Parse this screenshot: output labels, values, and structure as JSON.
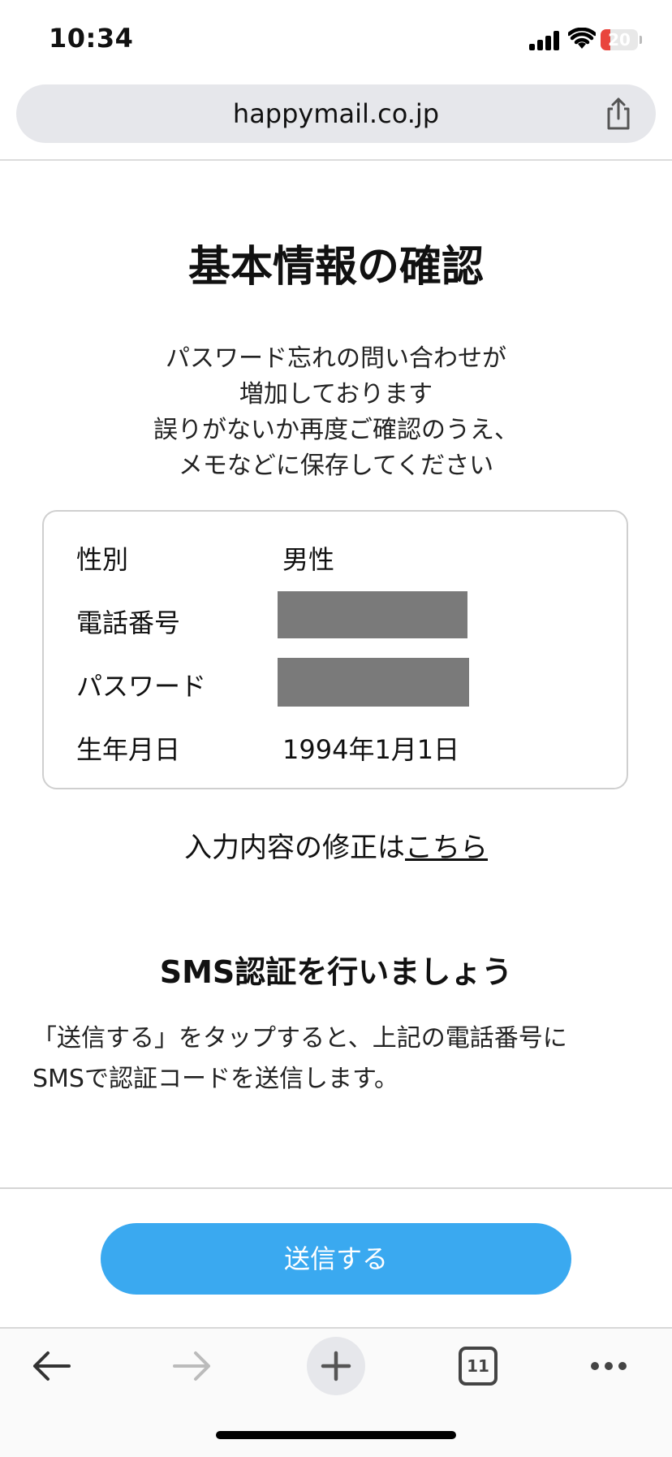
{
  "status_bar": {
    "time": "10:34",
    "battery": "20"
  },
  "browser": {
    "url": "happymail.co.jp",
    "tab_count": "11"
  },
  "page": {
    "title": "基本情報の確認",
    "notice_lines": [
      "パスワード忘れの問い合わせが",
      "増加しております",
      "誤りがないか再度ご確認のうえ、",
      "メモなどに保存してください"
    ],
    "info": {
      "gender_label": "性別",
      "gender_value": "男性",
      "phone_label": "電話番号",
      "password_label": "パスワード",
      "birthdate_label": "生年月日",
      "birthdate_value": "1994年1月1日"
    },
    "edit_prefix": "入力内容の修正は",
    "edit_link": "こちら",
    "sms_title": "SMS認証を行いましょう",
    "sms_desc_lines": [
      "「送信する」をタップすると、上記の電話番号に",
      "SMSで認証コードを送信します。"
    ],
    "submit_label": "送信する"
  },
  "colors": {
    "accent": "#3aa9f0",
    "battery_low": "#e9453d",
    "redaction": "#7a7a7a"
  },
  "icons": [
    "signal-icon",
    "wifi-icon",
    "battery-icon",
    "share-icon",
    "back-arrow-icon",
    "forward-arrow-icon",
    "plus-icon",
    "tabs-icon",
    "more-icon"
  ]
}
